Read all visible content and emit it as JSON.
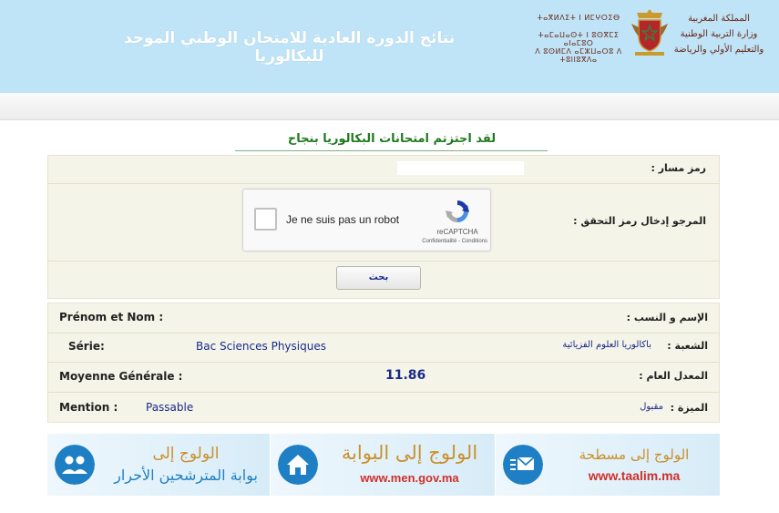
{
  "header": {
    "title": "نتائج الدورة العادية للامتحان الوطني الموحد للبكالوريا",
    "ministry_tifinagh": [
      "ⵜⴰⴳⵍⴷⵉⵜ ⵏ ⵍⵎⵖⵔⵉⴱ",
      "ⵜⴰⵎⴰⵡⴰⵙⵜ ⵏ ⵓⵙⴳⵎⵉ ⴰⵏⴰⵎⵓⵔ",
      "ⴷ ⵓⵙⵍⵎⴷ ⴰⵎⵣⵡⴰⵔⵓ ⴷ ⵜⵓⵏⵏⵓⴳⴷⴰ"
    ],
    "ministry_arabic": [
      "المملكة المغربية",
      "وزارة التربية الوطنية",
      "والتعليم الأولي والرياضة"
    ],
    "accent_color": "#bfe3f7"
  },
  "message": {
    "success": "لقد اجتزتم امتحانات البكالوريا بنجاح",
    "color": "#1f7a1f"
  },
  "form": {
    "code_label": "رمز مسار :",
    "code_value": "",
    "captcha_label": "المرجو إدخال رمز التحقق :",
    "captcha": {
      "checkbox_text": "Je ne suis pas un robot",
      "brand": "reCAPTCHA",
      "privacy": "Confidentialité",
      "separator": "-",
      "terms": "Conditions"
    },
    "search_button": "بحث"
  },
  "results": {
    "name_label_fr": "Prénom et Nom :",
    "name_label_ar": "الإسم و النسب :",
    "name_value": "",
    "serie_label_fr": "Série:",
    "serie_value_fr": "Bac Sciences Physiques",
    "serie_value_ar": "باكالوريا العلوم الفزيائية",
    "serie_label_ar": "الشعبة :",
    "moyenne_label_fr": "Moyenne Générale :",
    "moyenne_value": "11.86",
    "moyenne_label_ar": "المعدل العام :",
    "mention_label_fr": "Mention :",
    "mention_value_fr": "Passable",
    "mention_value_ar": "مقبول",
    "mention_label_ar": "الميزة :"
  },
  "banners": [
    {
      "line1": "الولوج إلى",
      "line2": "بوابة المترشحين الأحرار",
      "url": "",
      "icon": "users-icon"
    },
    {
      "line1": "الولوج إلى البوابة",
      "line2": "",
      "url": "www.men.gov.ma",
      "icon": "home-icon"
    },
    {
      "line1": "الولوج إلى مسطحة",
      "line2": "",
      "url": "www.taalim.ma",
      "icon": "mail-icon"
    }
  ]
}
